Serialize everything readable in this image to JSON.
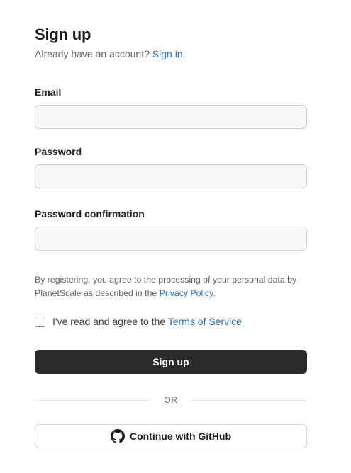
{
  "heading": {
    "title": "Sign up",
    "subtitle_prefix": "Already have an account?",
    "signin_link": "Sign in."
  },
  "form": {
    "email": {
      "label": "Email",
      "value": "",
      "placeholder": ""
    },
    "password": {
      "label": "Password",
      "value": "",
      "placeholder": ""
    },
    "password_confirmation": {
      "label": "Password confirmation",
      "value": "",
      "placeholder": ""
    }
  },
  "consent": {
    "text_prefix": "By registering, you agree to the processing of your personal data by PlanetScale as described in the",
    "privacy_link": "Privacy Policy",
    "text_suffix": "."
  },
  "terms": {
    "checked": false,
    "label_prefix": "I've read and agree to the",
    "terms_link": "Terms of Service"
  },
  "actions": {
    "signup_label": "Sign up",
    "divider_label": "OR",
    "github_label": "Continue with GitHub",
    "github_icon": "github-icon"
  },
  "colors": {
    "link": "#2a6fb0",
    "primary_button": "#2b2b2b",
    "input_background": "#f8f8f8"
  }
}
